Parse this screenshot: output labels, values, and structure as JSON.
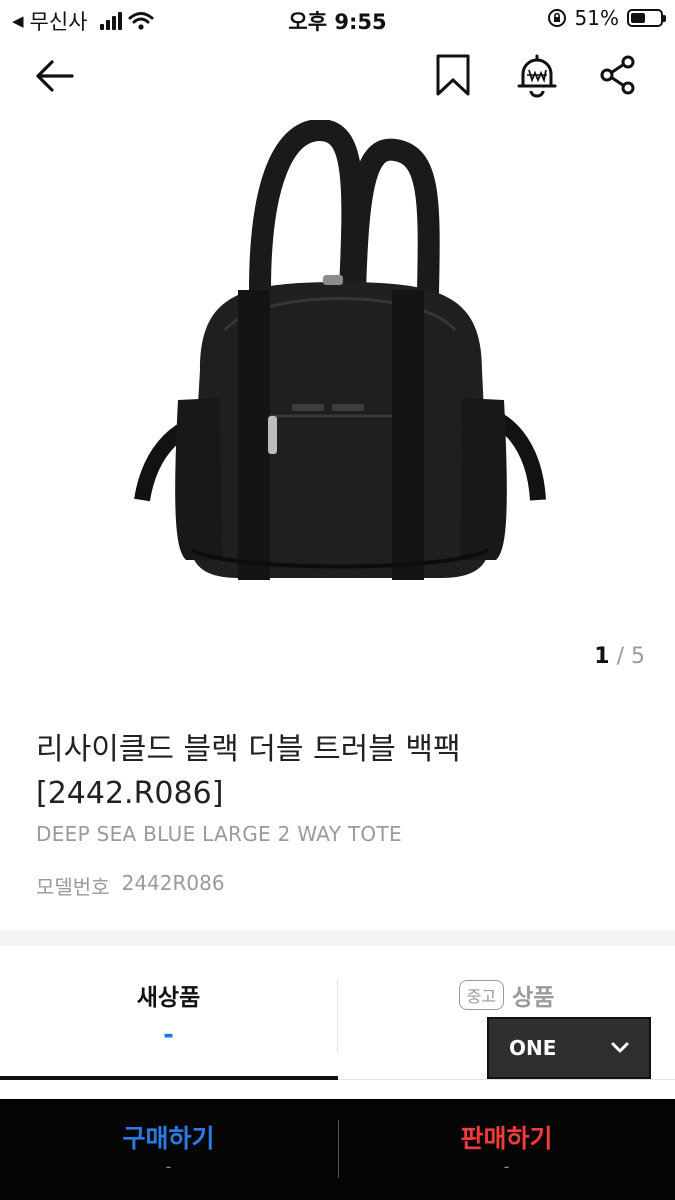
{
  "status_bar": {
    "back_app": "무신사",
    "time": "오후 9:55",
    "battery": "51%",
    "battery_level": 0.51
  },
  "nav": {
    "back_icon": "arrow-left-icon",
    "bookmark_icon": "bookmark-icon",
    "alert_icon": "price-alert-bell-icon",
    "share_icon": "share-icon"
  },
  "gallery": {
    "current": "1",
    "separator": "/",
    "total": "5"
  },
  "product": {
    "title": "리사이클드 블랙 더블 트러블 백팩 [2442.R086]",
    "subtitle": "DEEP SEA BLUE LARGE 2 WAY TOTE",
    "model_label": "모델번호",
    "model_number": "2442R086"
  },
  "tabs": {
    "new": {
      "label": "새상품",
      "price": "-"
    },
    "used": {
      "badge": "중고",
      "label": "상품"
    }
  },
  "size_select": {
    "value": "ONE"
  },
  "actions": {
    "buy": {
      "label": "구매하기",
      "price": "-"
    },
    "sell": {
      "label": "판매하기",
      "price": "-"
    }
  },
  "colors": {
    "buy_accent": "#2b7be6",
    "sell_accent": "#f23b3b",
    "price_accent": "#1d73e8"
  }
}
